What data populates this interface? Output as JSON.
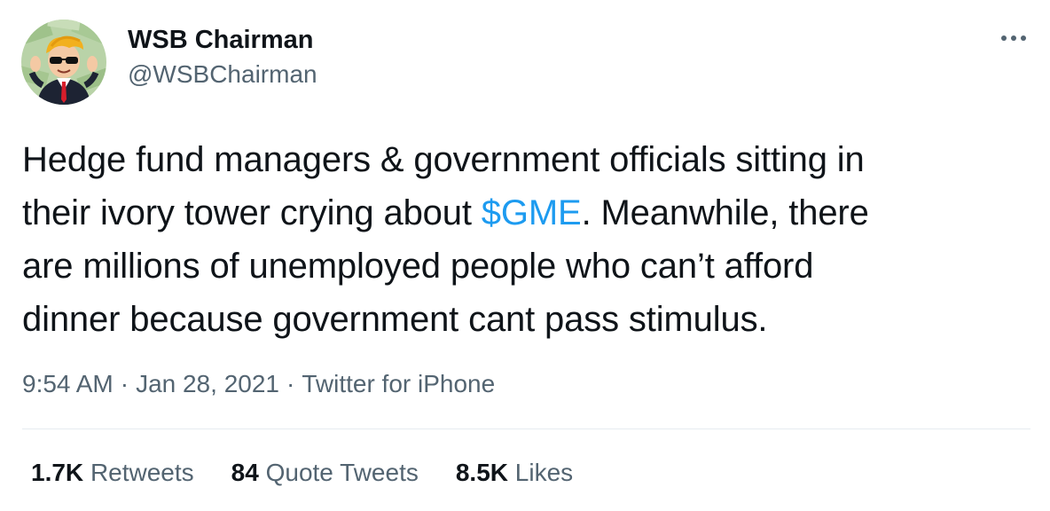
{
  "author": {
    "display_name": "WSB Chairman",
    "handle": "@WSBChairman",
    "avatar_icon": "wsb-mascot-avatar"
  },
  "more_icon": "more-horizontal-icon",
  "tweet": {
    "text_lines": [
      "Hedge fund managers & government officials sitting in",
      "their ivory tower crying about ",
      "are millions of unemployed people who can’t afford",
      "dinner because government cant pass stimulus."
    ],
    "cashtag": "$GME",
    "line2_after": ". Meanwhile, there"
  },
  "meta": {
    "time": "9:54 AM",
    "date": "Jan 28, 2021",
    "source": "Twitter for iPhone",
    "separator": "·"
  },
  "stats": {
    "retweets_count": "1.7K",
    "retweets_label": "Retweets",
    "quotes_count": "84",
    "quotes_label": "Quote Tweets",
    "likes_count": "8.5K",
    "likes_label": "Likes"
  },
  "colors": {
    "text": "#0f1419",
    "secondary": "#536471",
    "link": "#1d9bf0",
    "divider": "#e6ecf0"
  }
}
